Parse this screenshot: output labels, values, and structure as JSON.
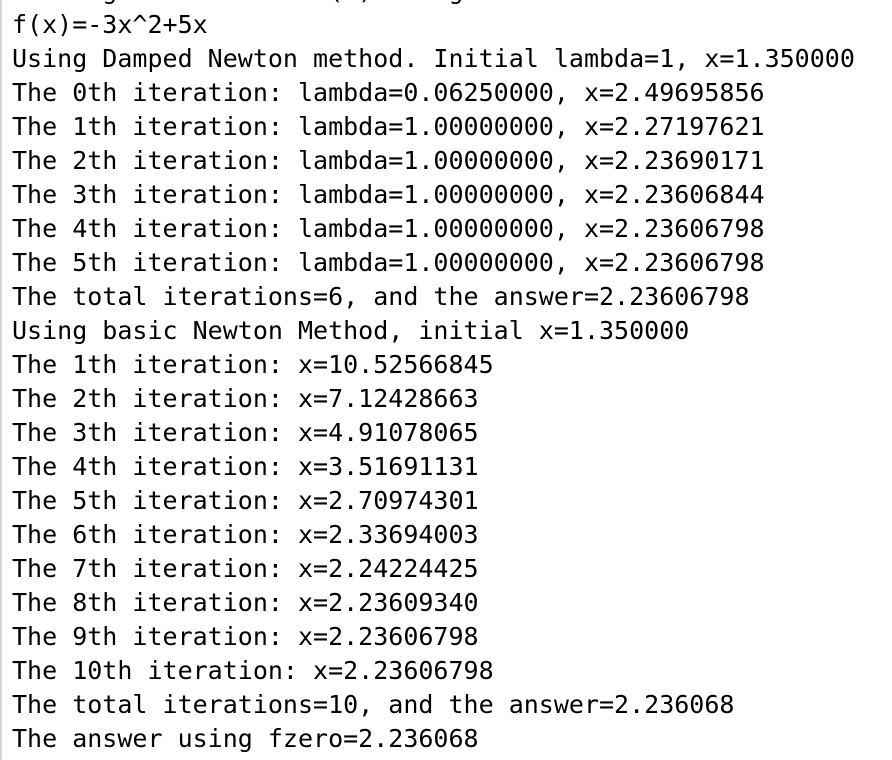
{
  "console": {
    "lines": [
      "Finding the root of f(x) using Newton methods",
      "f(x)=-3x^2+5x",
      "Using Damped Newton method. Initial lambda=1, x=1.350000",
      "The 0th iteration: lambda=0.06250000, x=2.49695856",
      "The 1th iteration: lambda=1.00000000, x=2.27197621",
      "The 2th iteration: lambda=1.00000000, x=2.23690171",
      "The 3th iteration: lambda=1.00000000, x=2.23606844",
      "The 4th iteration: lambda=1.00000000, x=2.23606798",
      "The 5th iteration: lambda=1.00000000, x=2.23606798",
      "The total iterations=6, and the answer=2.23606798",
      "Using basic Newton Method, initial x=1.350000",
      "The 1th iteration: x=10.52566845",
      "The 2th iteration: x=7.12428663",
      "The 3th iteration: x=4.91078065",
      "The 4th iteration: x=3.51691131",
      "The 5th iteration: x=2.70974301",
      "The 6th iteration: x=2.33694003",
      "The 7th iteration: x=2.24224425",
      "The 8th iteration: x=2.23609340",
      "The 9th iteration: x=2.23606798",
      "The 10th iteration: x=2.23606798",
      "The total iterations=10, and the answer=2.236068",
      "The answer using fzero=2.236068"
    ]
  }
}
